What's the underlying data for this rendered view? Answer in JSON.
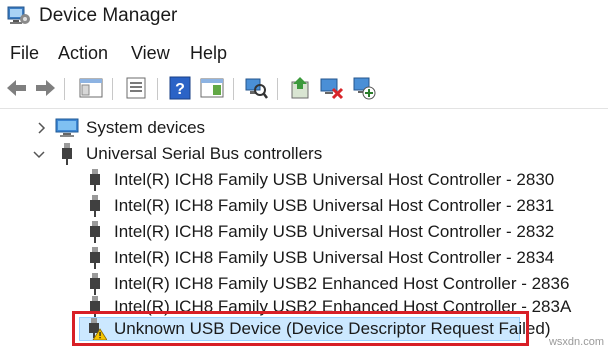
{
  "window": {
    "title": "Device Manager"
  },
  "menu": [
    "File",
    "Action",
    "View",
    "Help"
  ],
  "toolbar": {
    "icons": [
      "back-arrow-icon",
      "forward-arrow-icon",
      "console-tree-icon",
      "properties-icon",
      "help-icon",
      "action-pane-icon",
      "scan-hardware-icon",
      "update-driver-icon",
      "uninstall-device-icon",
      "add-legacy-hardware-icon"
    ]
  },
  "tree": {
    "system_devices": "System devices",
    "usb_controllers": "Universal Serial Bus controllers",
    "usb_children": [
      "Intel(R) ICH8 Family USB Universal Host Controller - 2830",
      "Intel(R) ICH8 Family USB Universal Host Controller - 2831",
      "Intel(R) ICH8 Family USB Universal Host Controller - 2832",
      "Intel(R) ICH8 Family USB Universal Host Controller - 2834",
      "Intel(R) ICH8 Family USB2 Enhanced Host Controller - 2836",
      "Intel(R) ICH8 Family USB2 Enhanced Host Controller - 283A",
      "Unknown USB Device (Device Descriptor Request Failed)"
    ]
  },
  "colors": {
    "highlight": "#cce8ff",
    "annotation_box": "#d81f26"
  },
  "watermark": "wsxdn.com"
}
